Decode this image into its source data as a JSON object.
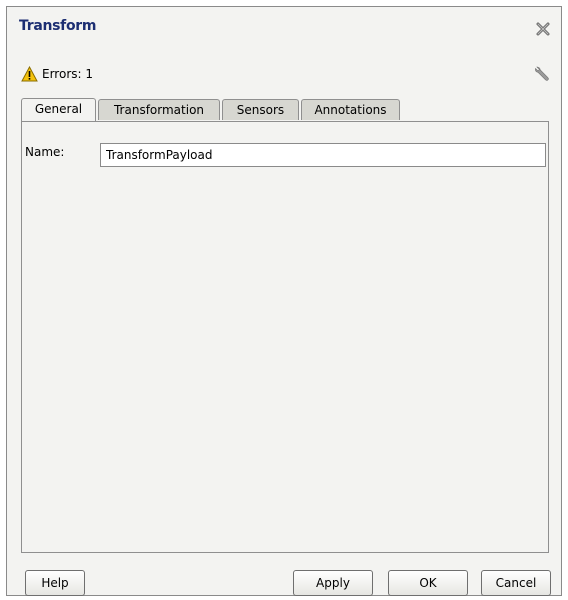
{
  "dialog": {
    "title": "Transform",
    "errors_text": "Errors: 1",
    "tabs": [
      {
        "label": "General",
        "active": true
      },
      {
        "label": "Transformation",
        "active": false
      },
      {
        "label": "Sensors",
        "active": false
      },
      {
        "label": "Annotations",
        "active": false
      }
    ],
    "name_label": "Name:",
    "name_value": "TransformPayload",
    "buttons": {
      "help": "Help",
      "apply": "Apply",
      "ok": "OK",
      "cancel": "Cancel"
    },
    "icons": {
      "close": "close-icon",
      "warning": "warning-icon",
      "wrench": "wrench-icon"
    },
    "colors": {
      "title": "#1c2e72",
      "warning": "#f4c20d"
    }
  }
}
